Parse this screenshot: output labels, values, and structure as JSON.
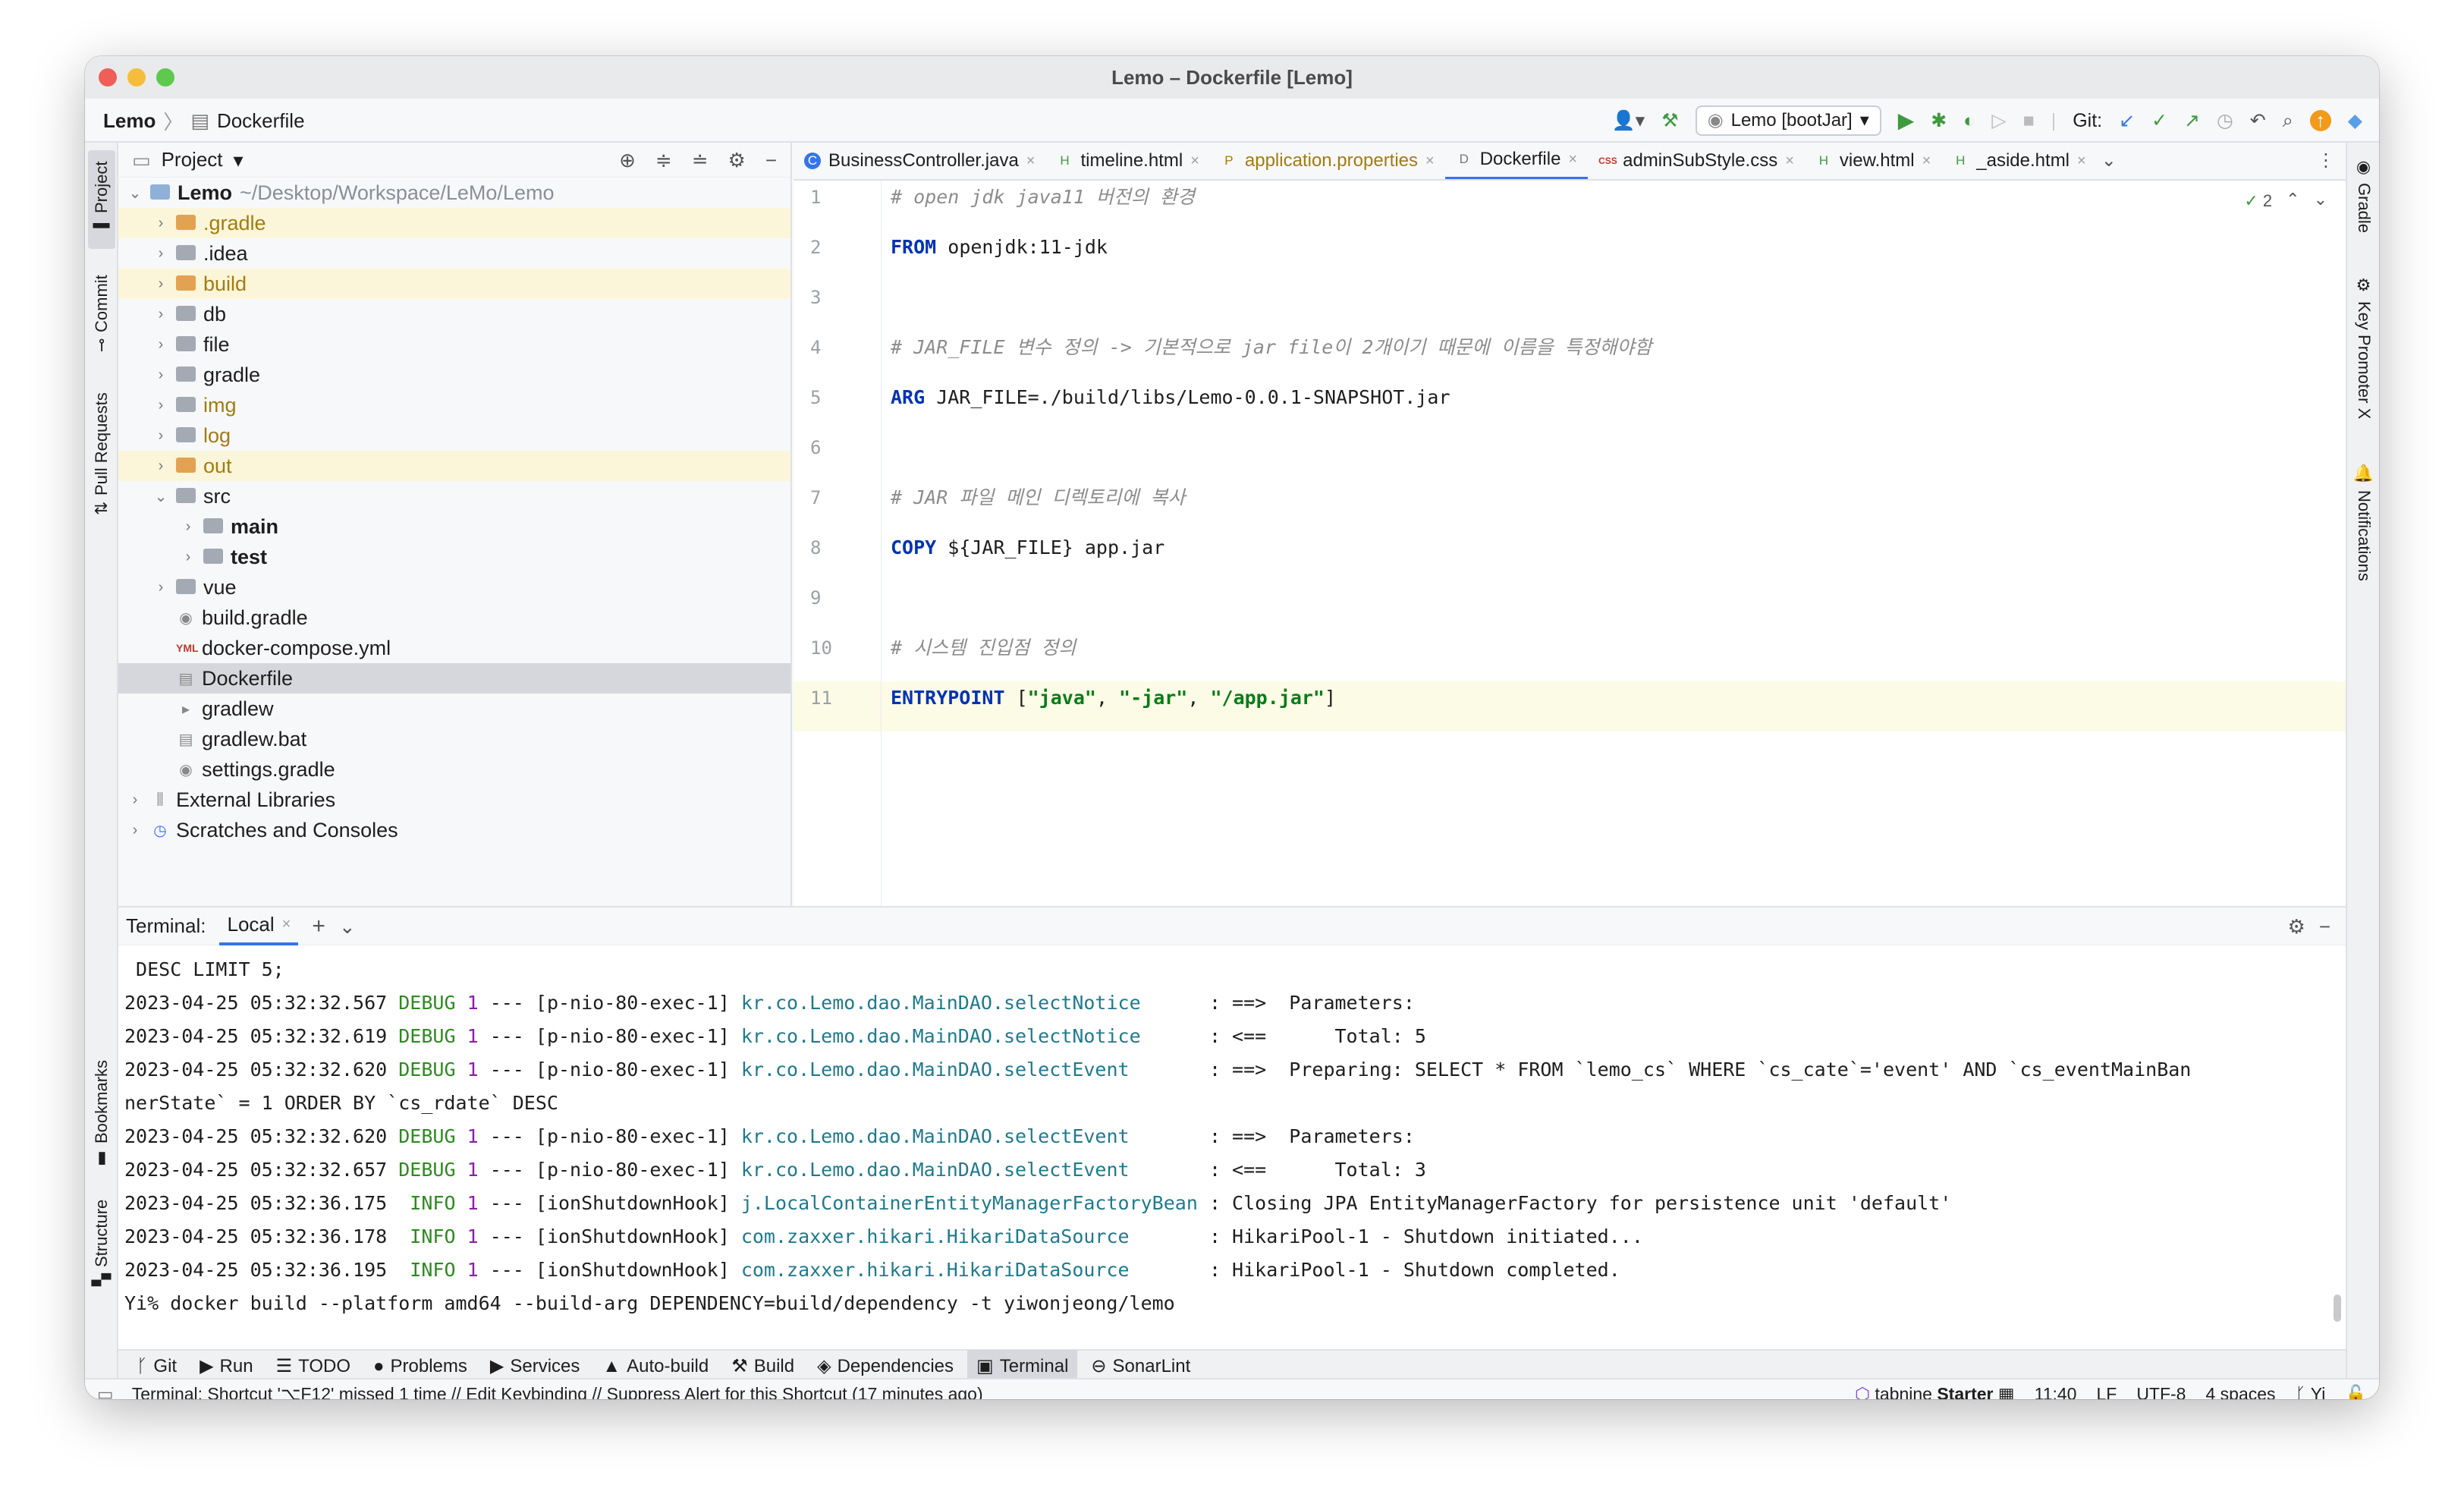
{
  "window": {
    "title": "Lemo – Dockerfile [Lemo]"
  },
  "toolbar": {
    "crumb_project": "Lemo",
    "crumb_file": "Dockerfile",
    "run_config": "Lemo [bootJar]",
    "git_label": "Git:"
  },
  "left_sidebar": {
    "project": "Project",
    "commit": "Commit",
    "pull_requests": "Pull Requests",
    "bookmarks": "Bookmarks",
    "structure": "Structure"
  },
  "right_sidebar": {
    "gradle": "Gradle",
    "key_promoter": "Key Promoter X",
    "notifications": "Notifications"
  },
  "project_panel": {
    "title": "Project",
    "root_name": "Lemo",
    "root_path": "~/Desktop/Workspace/LeMo/Lemo",
    "items": [
      {
        "label": ".gradle"
      },
      {
        "label": ".idea"
      },
      {
        "label": "build"
      },
      {
        "label": "db"
      },
      {
        "label": "file"
      },
      {
        "label": "gradle"
      },
      {
        "label": "img"
      },
      {
        "label": "log"
      },
      {
        "label": "out"
      },
      {
        "label": "src"
      },
      {
        "label": "main"
      },
      {
        "label": "test"
      },
      {
        "label": "vue"
      },
      {
        "label": "build.gradle"
      },
      {
        "label": "docker-compose.yml"
      },
      {
        "label": "Dockerfile"
      },
      {
        "label": "gradlew"
      },
      {
        "label": "gradlew.bat"
      },
      {
        "label": "settings.gradle"
      },
      {
        "label": "External Libraries"
      },
      {
        "label": "Scratches and Consoles"
      }
    ]
  },
  "tabs": [
    {
      "label": "BusinessController.java",
      "icon": "C"
    },
    {
      "label": "timeline.html",
      "icon": "H"
    },
    {
      "label": "application.properties",
      "icon": "P"
    },
    {
      "label": "Dockerfile",
      "icon": "D"
    },
    {
      "label": "adminSubStyle.css",
      "icon": "CSS"
    },
    {
      "label": "view.html",
      "icon": "H"
    },
    {
      "label": "_aside.html",
      "icon": "H"
    }
  ],
  "editor": {
    "inspection_count": "2",
    "line_numbers": [
      "1",
      "2",
      "3",
      "4",
      "5",
      "6",
      "7",
      "8",
      "9",
      "10",
      "11"
    ],
    "lines": {
      "l1": "# open jdk java11 버전의 환경",
      "l2_kw": "FROM",
      "l2_rest": " openjdk:11-jdk",
      "l4": "# JAR_FILE 변수 정의 -> 기본적으로 jar file이 2개이기 때문에 이름을 특정해야함",
      "l5_kw": "ARG",
      "l5_rest": " JAR_FILE=./build/libs/Lemo-0.0.1-SNAPSHOT.jar",
      "l7": "# JAR 파일 메인 디렉토리에 복사",
      "l8_kw": "COPY",
      "l8_rest": " ${JAR_FILE} app.jar",
      "l10": "# 시스템 진입점 정의",
      "l11_kw": "ENTRYPOINT",
      "l11_open": " [",
      "l11_s1": "\"java\"",
      "l11_c1": ", ",
      "l11_s2": "\"-jar\"",
      "l11_c2": ", ",
      "l11_s3": "\"/app.jar\"",
      "l11_close": "]"
    }
  },
  "terminal": {
    "label": "Terminal:",
    "tab": "Local",
    "first_line": " DESC LIMIT 5;",
    "log": [
      {
        "ts": "2023-04-25 05:32:32.567",
        "lvl": "DEBUG",
        "pid": "1",
        "thread": " --- [p-nio-80-exec-1] ",
        "cls": "kr.co.Lemo.dao.MainDAO.selectNotice     ",
        "msg": " : ==>  Parameters: "
      },
      {
        "ts": "2023-04-25 05:32:32.619",
        "lvl": "DEBUG",
        "pid": "1",
        "thread": " --- [p-nio-80-exec-1] ",
        "cls": "kr.co.Lemo.dao.MainDAO.selectNotice     ",
        "msg": " : <==      Total: 5"
      },
      {
        "ts": "2023-04-25 05:32:32.620",
        "lvl": "DEBUG",
        "pid": "1",
        "thread": " --- [p-nio-80-exec-1] ",
        "cls": "kr.co.Lemo.dao.MainDAO.selectEvent      ",
        "msg": " : ==>  Preparing: SELECT * FROM `lemo_cs` WHERE `cs_cate`='event' AND `cs_eventMainBan"
      },
      {
        "ts": "2023-04-25 05:32:32.620",
        "lvl": "DEBUG",
        "pid": "1",
        "thread": " --- [p-nio-80-exec-1] ",
        "cls": "kr.co.Lemo.dao.MainDAO.selectEvent      ",
        "msg": " : ==>  Parameters: "
      },
      {
        "ts": "2023-04-25 05:32:32.657",
        "lvl": "DEBUG",
        "pid": "1",
        "thread": " --- [p-nio-80-exec-1] ",
        "cls": "kr.co.Lemo.dao.MainDAO.selectEvent      ",
        "msg": " : <==      Total: 3"
      },
      {
        "ts": "2023-04-25 05:32:36.175",
        "lvl": " INFO",
        "pid": "1",
        "thread": " --- [ionShutdownHook] ",
        "cls": "j.LocalContainerEntityManagerFactoryBean",
        "msg": " : Closing JPA EntityManagerFactory for persistence unit 'default'"
      },
      {
        "ts": "2023-04-25 05:32:36.178",
        "lvl": " INFO",
        "pid": "1",
        "thread": " --- [ionShutdownHook] ",
        "cls": "com.zaxxer.hikari.HikariDataSource      ",
        "msg": " : HikariPool-1 - Shutdown initiated..."
      },
      {
        "ts": "2023-04-25 05:32:36.195",
        "lvl": " INFO",
        "pid": "1",
        "thread": " --- [ionShutdownHook] ",
        "cls": "com.zaxxer.hikari.HikariDataSource      ",
        "msg": " : HikariPool-1 - Shutdown completed."
      }
    ],
    "wrap_line": "nerState` = 1 ORDER BY `cs_rdate` DESC",
    "prompt_line": "Yi% docker build --platform amd64 --build-arg DEPENDENCY=build/dependency -t yiwonjeong/lemo"
  },
  "bottom_tools": [
    {
      "label": "Git",
      "icon": "branch-icon",
      "glyph": "ᚴ"
    },
    {
      "label": "Run",
      "icon": "run-icon",
      "glyph": "▶"
    },
    {
      "label": "TODO",
      "icon": "todo-icon",
      "glyph": "☰"
    },
    {
      "label": "Problems",
      "icon": "problems-icon",
      "glyph": "●"
    },
    {
      "label": "Services",
      "icon": "services-icon",
      "glyph": "▶"
    },
    {
      "label": "Auto-build",
      "icon": "auto-build-icon",
      "glyph": "▲"
    },
    {
      "label": "Build",
      "icon": "build-hammer-icon",
      "glyph": "⚒"
    },
    {
      "label": "Dependencies",
      "icon": "dependencies-icon",
      "glyph": "◈"
    },
    {
      "label": "Terminal",
      "icon": "terminal-icon",
      "glyph": "▣"
    },
    {
      "label": "SonarLint",
      "icon": "sonarlint-icon",
      "glyph": "⊖"
    }
  ],
  "status": {
    "message": "Terminal: Shortcut '⌥F12' missed 1 time // Edit Keybinding // Suppress Alert for this Shortcut (17 minutes ago)",
    "tabnine": "tabnine",
    "tabnine_plan": "Starter",
    "position": "11:40",
    "line_sep": "LF",
    "encoding": "UTF-8",
    "indent": "4 spaces",
    "branch": "Yi"
  },
  "colors": {
    "accent": "#3574f0",
    "run_green": "#3d9a3d",
    "comment": "#8c8c8c",
    "keyword": "#0033b3",
    "string": "#067d17"
  }
}
